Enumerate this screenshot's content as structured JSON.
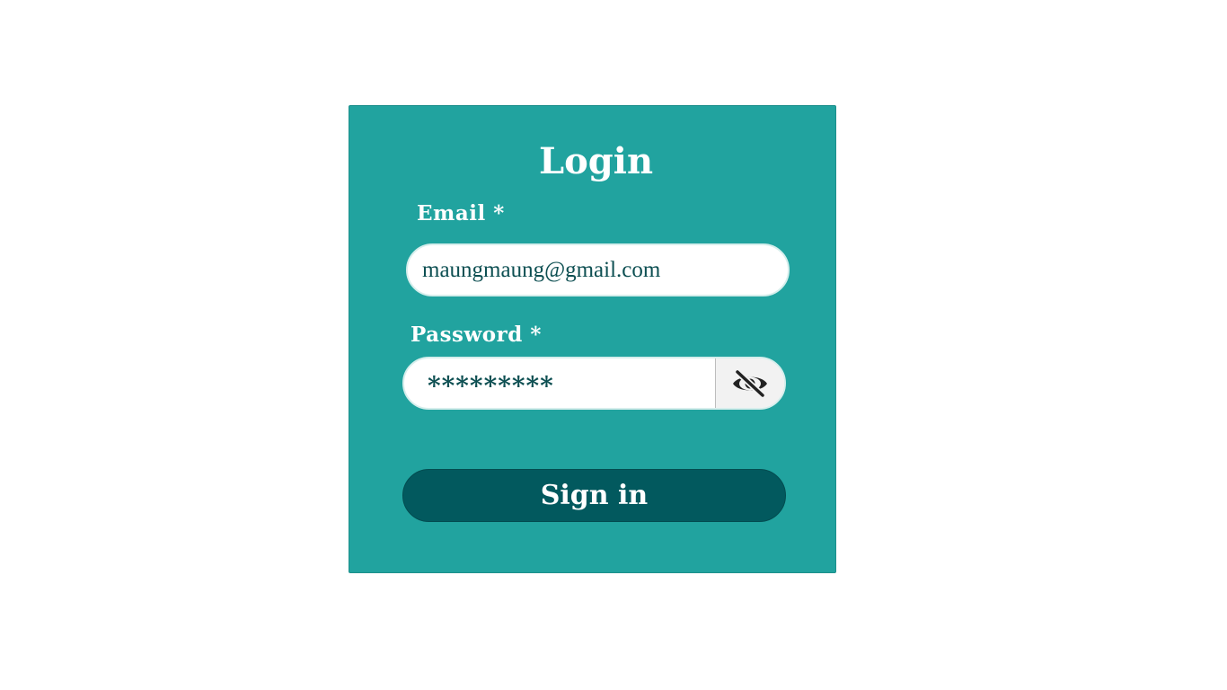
{
  "form": {
    "title": "Login",
    "email_label": "Email *",
    "email_value": "maungmaung@gmail.com",
    "password_label": "Password *",
    "password_value": "*********",
    "toggle_icon": "eye-slash-icon",
    "submit_label": "Sign in"
  },
  "colors": {
    "card_background": "#21a39f",
    "button_background": "#02595e",
    "input_text": "#0d4f52",
    "label_text": "#ffffff"
  }
}
